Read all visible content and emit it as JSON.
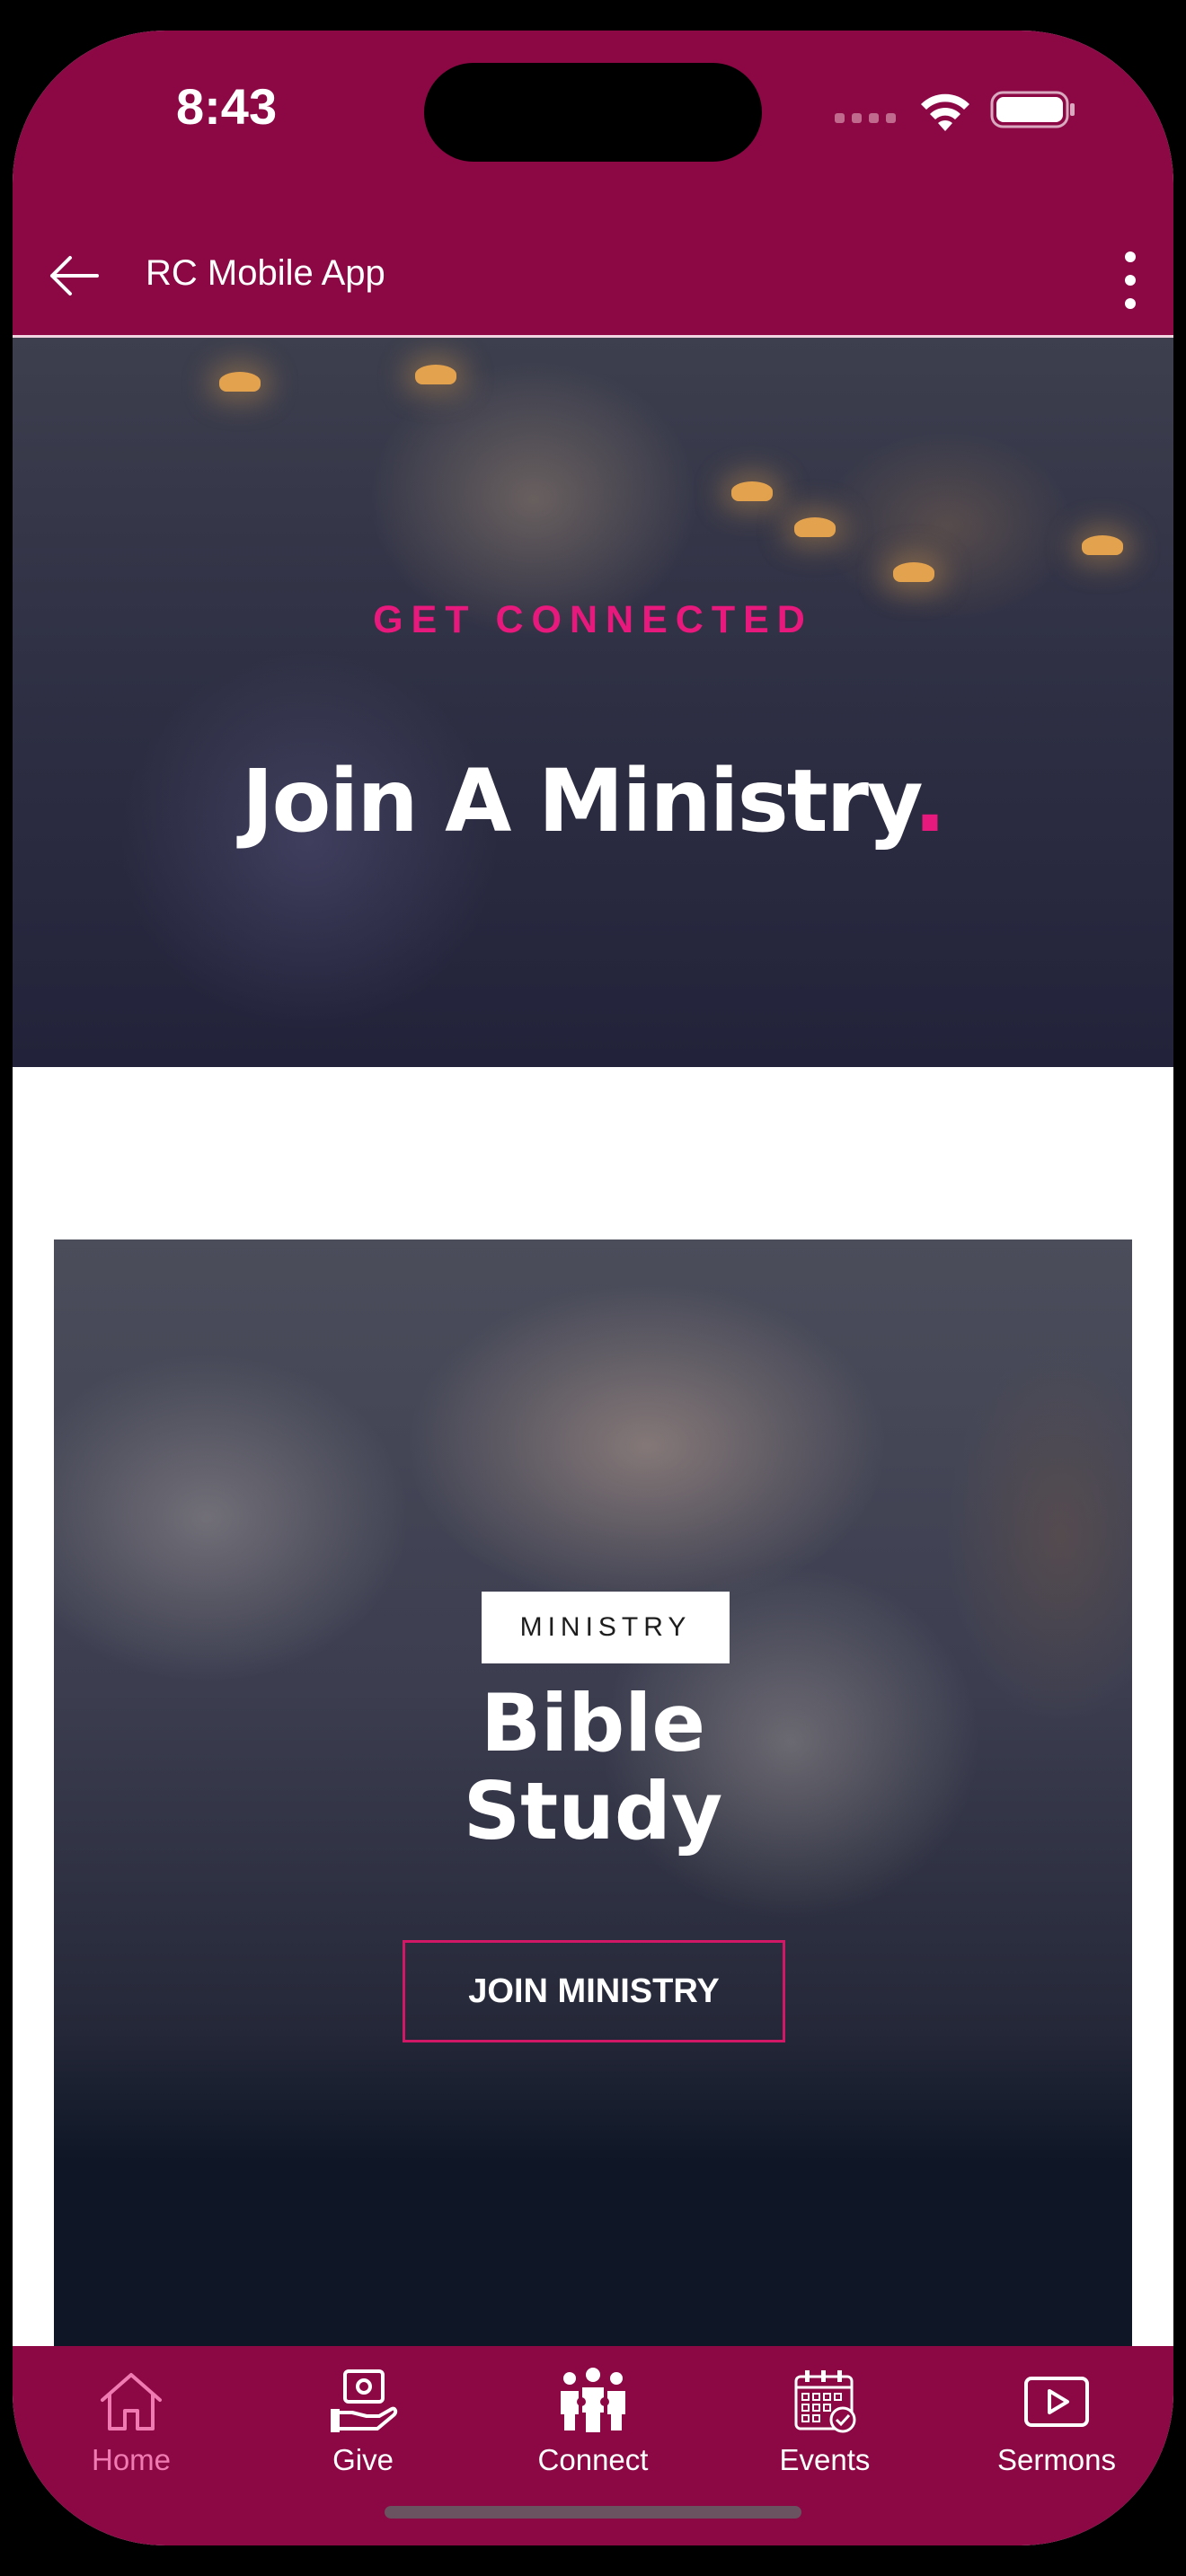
{
  "status_bar": {
    "time": "8:43"
  },
  "app_bar": {
    "title": "RC Mobile App"
  },
  "hero": {
    "kicker": "GET CONNECTED",
    "title": "Join A Ministry",
    "title_accent": "."
  },
  "ministry_card": {
    "tag": "MINISTRY",
    "title_line1": "Bible",
    "title_line2": "Study",
    "button_label": "JOIN MINISTRY"
  },
  "tabs": [
    {
      "label": "Home",
      "icon": "home-icon",
      "active": true
    },
    {
      "label": "Give",
      "icon": "give-icon",
      "active": false
    },
    {
      "label": "Connect",
      "icon": "connect-icon",
      "active": false
    },
    {
      "label": "Events",
      "icon": "events-icon",
      "active": false
    },
    {
      "label": "Sermons",
      "icon": "sermons-icon",
      "active": false
    }
  ],
  "colors": {
    "brand": "#8b0845",
    "accent": "#e8197c",
    "active_tab": "#f07bb3"
  }
}
